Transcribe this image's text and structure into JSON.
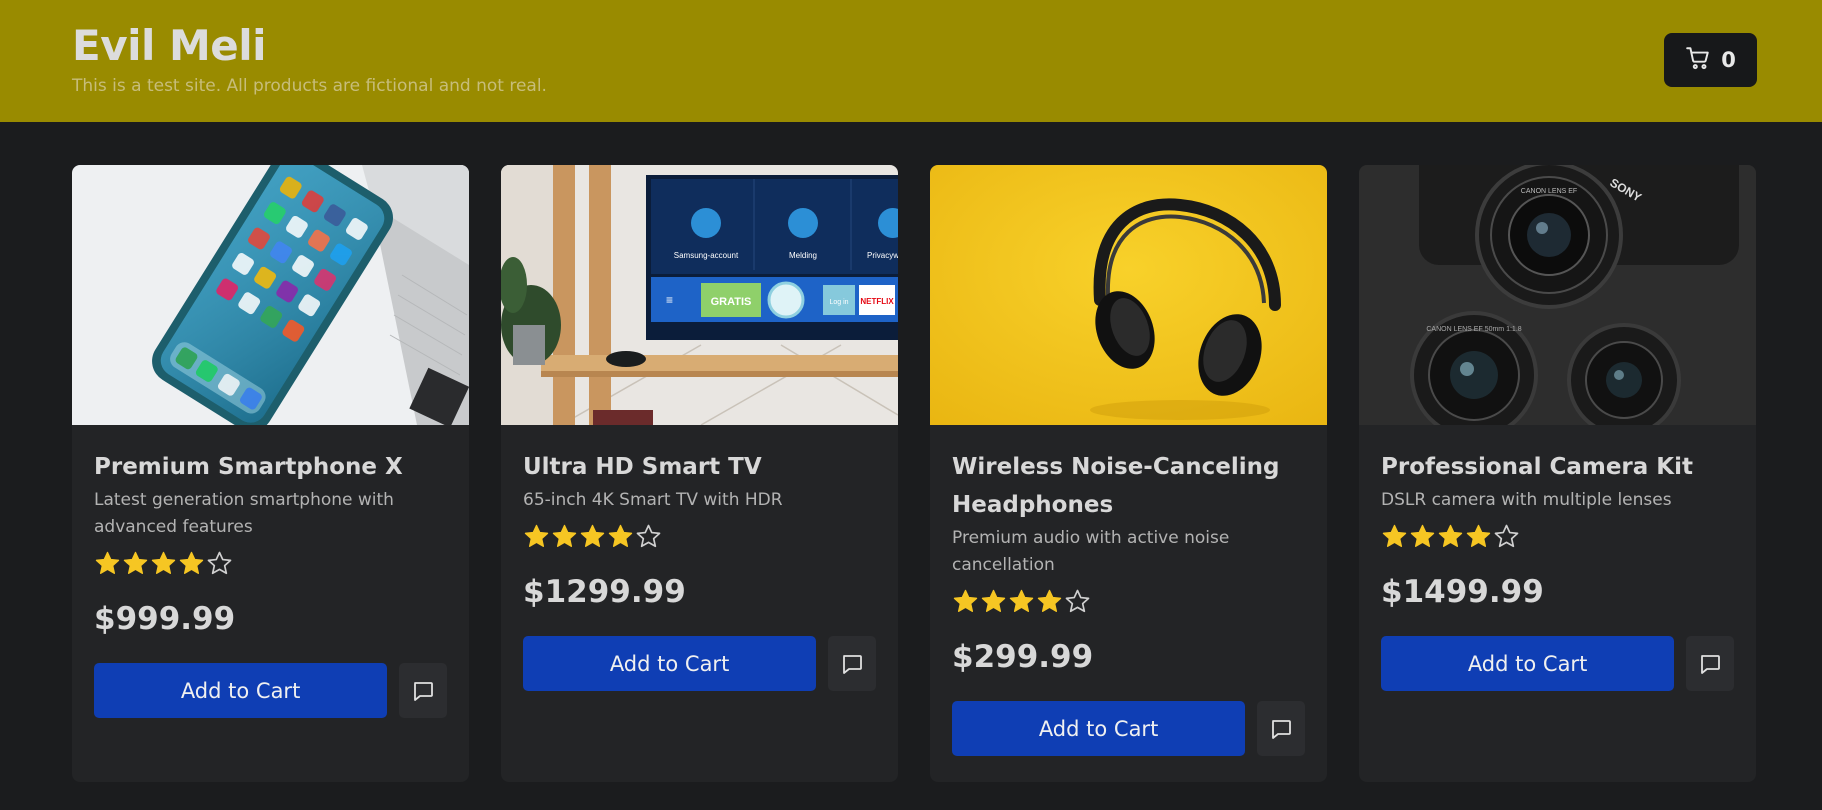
{
  "header": {
    "title": "Evil Meli",
    "subtitle": "This is a test site. All products are fictional and not real.",
    "cart_count": "0",
    "cart_icon": "shopping-cart-icon"
  },
  "colors": {
    "header_bg": "#998b00",
    "page_bg": "#1b1c1e",
    "card_bg": "#232426",
    "button_blue": "#0f3eb4",
    "star_yellow": "#f6c623"
  },
  "products": [
    {
      "title": "Premium Smartphone X",
      "description": "Latest generation smartphone with advanced features",
      "rating": 4,
      "rating_max": 5,
      "price": "$999.99",
      "button_label": "Add to Cart"
    },
    {
      "title": "Ultra HD Smart TV",
      "description": "65-inch 4K Smart TV with HDR",
      "rating": 4,
      "rating_max": 5,
      "price": "$1299.99",
      "button_label": "Add to Cart",
      "image_text": {
        "tile1": "Samsung-account",
        "tile2": "Melding",
        "tile3": "Privacyw",
        "banner1": "GRATIS",
        "banner2": "NETFLIX",
        "banner3": "Log in"
      }
    },
    {
      "title": "Wireless Noise-Canceling Headphones",
      "description": "Premium audio with active noise cancellation",
      "rating": 4,
      "rating_max": 5,
      "price": "$299.99",
      "button_label": "Add to Cart"
    },
    {
      "title": "Professional Camera Kit",
      "description": "DSLR camera with multiple lenses",
      "rating": 4,
      "rating_max": 5,
      "price": "$1499.99",
      "button_label": "Add to Cart",
      "image_text": {
        "brand": "SONY",
        "lens1": "CANON LENS EF",
        "lens2": "CANON LENS EF 50mm 1:1.8"
      }
    }
  ]
}
